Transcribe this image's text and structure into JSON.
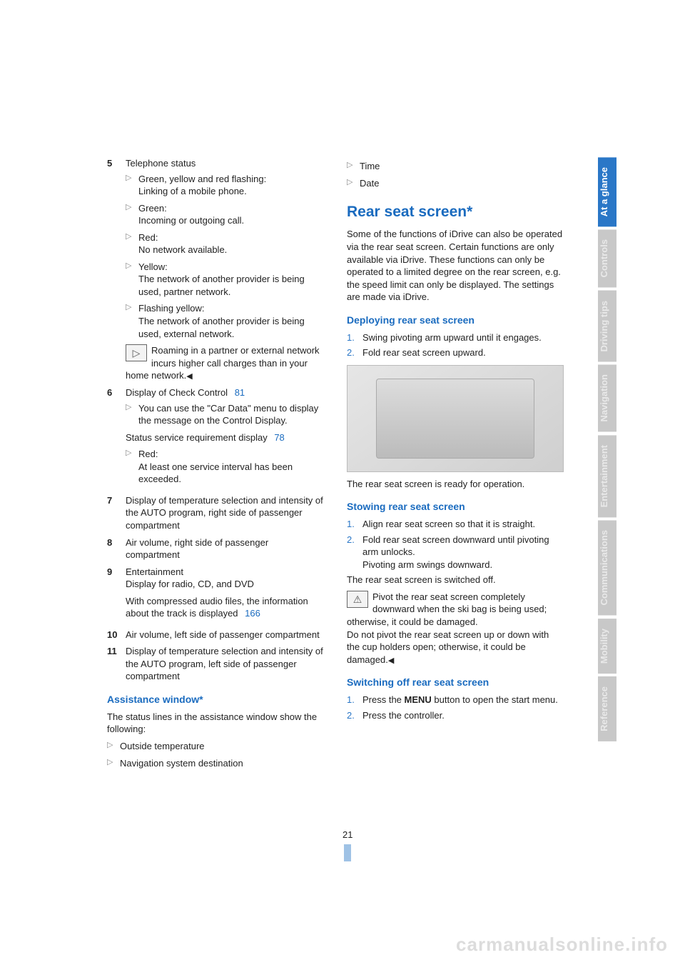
{
  "page_number": "21",
  "watermark": "carmanualsonline.info",
  "side_tabs": [
    {
      "label": "At a glance",
      "active": true
    },
    {
      "label": "Controls",
      "active": false
    },
    {
      "label": "Driving tips",
      "active": false
    },
    {
      "label": "Navigation",
      "active": false
    },
    {
      "label": "Entertainment",
      "active": false
    },
    {
      "label": "Communications",
      "active": false
    },
    {
      "label": "Mobility",
      "active": false
    },
    {
      "label": "Reference",
      "active": false
    }
  ],
  "left": {
    "items": [
      {
        "num": "5",
        "lead": "Telephone status",
        "subs": [
          {
            "t1": "Green, yellow and red flashing:",
            "t2": "Linking of a mobile phone."
          },
          {
            "t1": "Green:",
            "t2": "Incoming or outgoing call."
          },
          {
            "t1": "Red:",
            "t2": "No network available."
          },
          {
            "t1": "Yellow:",
            "t2": "The network of another provider is being used, partner network."
          },
          {
            "t1": "Flashing yellow:",
            "t2": "The network of another provider is being used, external network."
          }
        ],
        "note": "Roaming in a partner or external network incurs higher call charges than in your home network."
      },
      {
        "num": "6",
        "lead": "Display of Check Control",
        "lead_ref": "81",
        "subs": [
          {
            "t1": "You can use the \"Car Data\" menu to display the message on the Control Display."
          }
        ],
        "plain": "Status service requirement display",
        "plain_ref": "78",
        "subs2": [
          {
            "t1": "Red:",
            "t2": "At least one service interval has been exceeded."
          }
        ]
      },
      {
        "num": "7",
        "lead": "Display of temperature selection and intensity of the AUTO program, right side of passenger compartment"
      },
      {
        "num": "8",
        "lead": "Air volume, right side of passenger compartment"
      },
      {
        "num": "9",
        "lead": "Entertainment",
        "lead2": "Display for radio, CD, and DVD",
        "plain": "With compressed audio files, the information about the track is displayed",
        "plain_ref": "166"
      },
      {
        "num": "10",
        "lead": "Air volume, left side of passenger compartment"
      },
      {
        "num": "11",
        "lead": "Display of temperature selection and intensity of the AUTO program, left side of passenger compartment"
      }
    ],
    "h2_assist": "Assistance window*",
    "assist_intro": "The status lines in the assistance window show the following:",
    "assist_bullets": [
      "Outside temperature",
      "Navigation system destination"
    ]
  },
  "right": {
    "top_bullets": [
      "Time",
      "Date"
    ],
    "h1": "Rear seat screen*",
    "intro": "Some of the functions of iDrive can also be operated via the rear seat screen. Certain functions are only available via iDrive. These functions can only be operated to a limited degree on the rear screen, e.g. the speed limit can only be displayed. The settings are made via iDrive.",
    "deploy_h2": "Deploying rear seat screen",
    "deploy_steps": [
      "Swing pivoting arm upward until it engages.",
      "Fold rear seat screen upward."
    ],
    "after_img": "The rear seat screen is ready for operation.",
    "stow_h2": "Stowing rear seat screen",
    "stow_steps": [
      "Align rear seat screen so that it is straight.",
      "Fold rear seat screen downward until pivoting arm unlocks.\nPivoting arm swings downward."
    ],
    "stow_after": "The rear seat screen is switched off.",
    "stow_warn": "Pivot the rear seat screen completely downward when the ski bag is being used; otherwise, it could be damaged.\nDo not pivot the rear seat screen up or down with the cup holders open; otherwise, it could be damaged.",
    "switch_h2": "Switching off rear seat screen",
    "switch_steps_pre": "Press the ",
    "switch_steps_bold": "MENU",
    "switch_steps_post": " button to open the start menu.",
    "switch_step2": "Press the controller."
  }
}
